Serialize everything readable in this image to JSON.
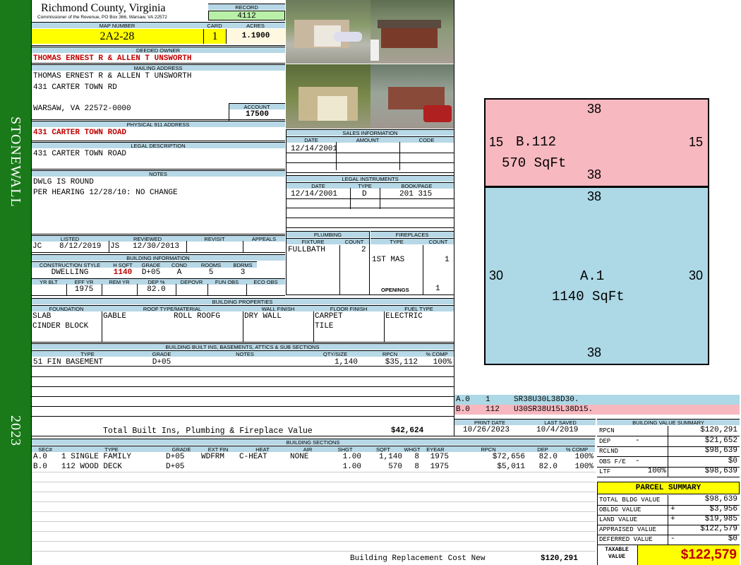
{
  "district": "STONEWALL",
  "year": "2023",
  "header": {
    "county": "Richmond County, Virginia",
    "subtitle": "Commissioner of the Revenue, PO Box 366, Warsaw, VA 22572",
    "record_label": "RECORD",
    "record": "4112",
    "map_label": "MAP NUMBER",
    "map": "2A2-28",
    "card_label": "CARD",
    "card": "1",
    "acres_label": "ACRES",
    "acres": "1.1900"
  },
  "owner": {
    "label": "DEEDED OWNER",
    "name": "THOMAS ERNEST R & ALLEN T UNSWORTH"
  },
  "mailing": {
    "label": "MAILING ADDRESS",
    "line1": "THOMAS ERNEST R & ALLEN T UNSWORTH",
    "line2": "431 CARTER TOWN RD",
    "line3": "WARSAW, VA 22572-0000",
    "account_label": "ACCOUNT",
    "account": "17500"
  },
  "physical": {
    "label": "PHYSICAL 911 ADDRESS",
    "address": "431 CARTER TOWN ROAD"
  },
  "legal": {
    "label": "LEGAL DESCRIPTION",
    "text": "431 CARTER TOWN ROAD"
  },
  "notes": {
    "label": "NOTES",
    "line1": "DWLG IS ROUND",
    "line2": "PER HEARING 12/28/10: NO CHANGE"
  },
  "listing": {
    "listed_label": "LISTED",
    "reviewed_label": "REVIEWED",
    "revisit_label": "REVISIT",
    "appeals_label": "APPEALS",
    "listed_by": "JC",
    "listed_date": "8/12/2019",
    "reviewed_by": "JS",
    "reviewed_date": "12/30/2013"
  },
  "building_info": {
    "label": "BUILDING INFORMATION",
    "h": [
      "CONSTRUCTION STYLE",
      "H SQFT",
      "GRADE",
      "COND",
      "ROOMS",
      "BDRMS"
    ],
    "v": [
      "DWELLING",
      "1140",
      "D+05",
      "A",
      "5",
      "3"
    ],
    "h2": [
      "YR BLT",
      "EFF YR",
      "REM YR",
      "DEP %",
      "DEPOVR",
      "FUN OBS",
      "ECO OBS"
    ],
    "v2": [
      "",
      "1975",
      "",
      "82.0",
      "",
      "",
      ""
    ]
  },
  "sales": {
    "label": "SALES INFORMATION",
    "h": [
      "DATE",
      "AMOUNT",
      "CODE"
    ],
    "date": "12/14/2001"
  },
  "legal_instr": {
    "label": "LEGAL INSTRUMENTS",
    "h": [
      "DATE",
      "TYPE",
      "BOOK/PAGE"
    ],
    "date": "12/14/2001",
    "type": "D",
    "book": "201 315"
  },
  "plumbing": {
    "label": "PLUMBING",
    "h": [
      "FIXTURE",
      "COUNT"
    ],
    "fixture": "FULLBATH",
    "count": "2"
  },
  "fireplaces": {
    "label": "FIREPLACES",
    "h": [
      "TYPE",
      "COUNT"
    ],
    "type": "1ST MAS",
    "count": "1",
    "openings_label": "OPENINGS",
    "openings": "1"
  },
  "properties": {
    "label": "BUILDING PROPERTIES",
    "h": [
      "FOUNDATION",
      "ROOF TYPE/MATERIAL",
      "WALL FINISH",
      "FLOOR FINISH",
      "FUEL TYPE"
    ],
    "foundation1": "SLAB",
    "foundation2": "CINDER BLOCK",
    "roof1": "GABLE",
    "roof2": "ROLL ROOFG",
    "wall": "DRY WALL",
    "floor1": "CARPET",
    "floor2": "TILE",
    "fuel": "ELECTRIC"
  },
  "builtins": {
    "label": "BUILDING BUILT INS, BASEMENTS, ATTICS & SUB SECTIONS",
    "h": [
      "TYPE",
      "GRADE",
      "NOTES",
      "QTY/SIZE",
      "RPCN",
      "% COMP"
    ],
    "row": [
      "51 FIN BASEMENT",
      "D+05",
      "",
      "1,140",
      "$35,112",
      "100%"
    ],
    "total_label": "Total Built Ins, Plumbing & Fireplace Value",
    "total": "$42,624"
  },
  "sections": {
    "label": "BUILDING SECTIONS",
    "h": [
      "SEC#",
      "TYPE",
      "GRADE",
      "EXT FIN",
      "HEAT",
      "AIR",
      "SHGT",
      "SQFT",
      "WHGT",
      "EYEAR",
      "RPCN",
      "DEP",
      "% COMP"
    ],
    "rows": [
      [
        "A.0",
        "1 SINGLE FAMILY",
        "D+05",
        "WDFRM",
        "C-HEAT",
        "NONE",
        "1.00",
        "1,140",
        "8",
        "1975",
        "$72,656",
        "82.0",
        "100%"
      ],
      [
        "B.0",
        "112 WOOD DECK",
        "D+05",
        "",
        "",
        "",
        "1.00",
        "570",
        "8",
        "1975",
        "$5,011",
        "82.0",
        "100%"
      ]
    ],
    "replacement_label": "Building Replacement Cost New",
    "replacement": "$120,291"
  },
  "sketch": {
    "b": {
      "top": "38",
      "left": "15",
      "right": "15",
      "bottom": "38",
      "label": "B.112",
      "area": "570 SqFt"
    },
    "a": {
      "top": "38",
      "left": "30",
      "right": "30",
      "bottom": "38",
      "label": "A.1",
      "area": "1140 SqFt"
    },
    "colors": {
      "b": "#f7b8c0",
      "a": "#add8e6"
    }
  },
  "vectors": [
    {
      "sec": "A.0",
      "code": "1",
      "vec": "SR38U30L38D30."
    },
    {
      "sec": "B.0",
      "code": "112",
      "vec": "U30SR38U15L38D15."
    }
  ],
  "print": {
    "print_label": "PRINT DATE",
    "saved_label": "LAST SAVED",
    "print_date": "10/26/2023",
    "saved": "10/4/2019"
  },
  "bvs": {
    "label": "BUILDING VALUE SUMMARY",
    "rows": [
      [
        "RPCN",
        "",
        "$120,291"
      ],
      [
        "DEP",
        "-",
        "$21,652"
      ],
      [
        "RCLND",
        "",
        "$98,639"
      ],
      [
        "OBS F/E",
        "-",
        "$0"
      ],
      [
        "LTF",
        "100%",
        "$98,639"
      ]
    ]
  },
  "parcel": {
    "label": "PARCEL SUMMARY",
    "rows": [
      [
        "TOTAL BLDG VALUE",
        "",
        "$98,639"
      ],
      [
        "OBLDG VALUE",
        "+",
        "$3,956"
      ],
      [
        "LAND VALUE",
        "+",
        "$19,985"
      ],
      [
        "APPRAISED VALUE",
        "",
        "$122,579"
      ],
      [
        "DEFERRED VALUE",
        "-",
        "$0"
      ]
    ],
    "taxable_label": "TAXABLE VALUE",
    "taxable": "$122,579"
  }
}
